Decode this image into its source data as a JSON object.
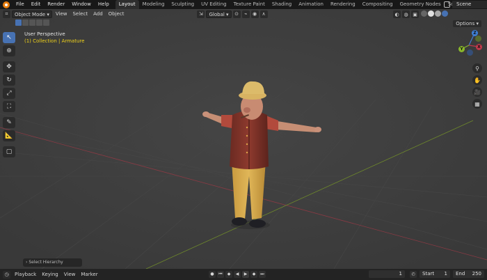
{
  "topbar": {
    "menus": [
      "File",
      "Edit",
      "Render",
      "Window",
      "Help"
    ],
    "workspaces": [
      "Layout",
      "Modeling",
      "Sculpting",
      "UV Editing",
      "Texture Paint",
      "Shading",
      "Animation",
      "Rendering",
      "Compositing",
      "Geometry Nodes",
      "Scripting"
    ],
    "active_workspace": "Layout",
    "scene": "Scene"
  },
  "viewport": {
    "mode": "Object Mode",
    "menus": [
      "View",
      "Select",
      "Add",
      "Object"
    ],
    "orientation": "Global",
    "options": "Options",
    "title": "User Perspective",
    "subtitle": "(1) Collection | Armature",
    "hierarchy_placeholder": "Select Hierarchy"
  },
  "gizmo": {
    "x": "X",
    "y": "Y",
    "z": "Z"
  },
  "timeline": {
    "menus": [
      "Playback",
      "Keying",
      "View",
      "Marker"
    ],
    "current_frame": "1",
    "start_label": "Start",
    "start": "1",
    "end_label": "End",
    "end": "250"
  },
  "colors": {
    "accent": "#4772b3",
    "x_axis": "#c0394b",
    "y_axis": "#8ab82c",
    "z_axis": "#3e7fd6",
    "collection_text": "#f0d21a"
  }
}
